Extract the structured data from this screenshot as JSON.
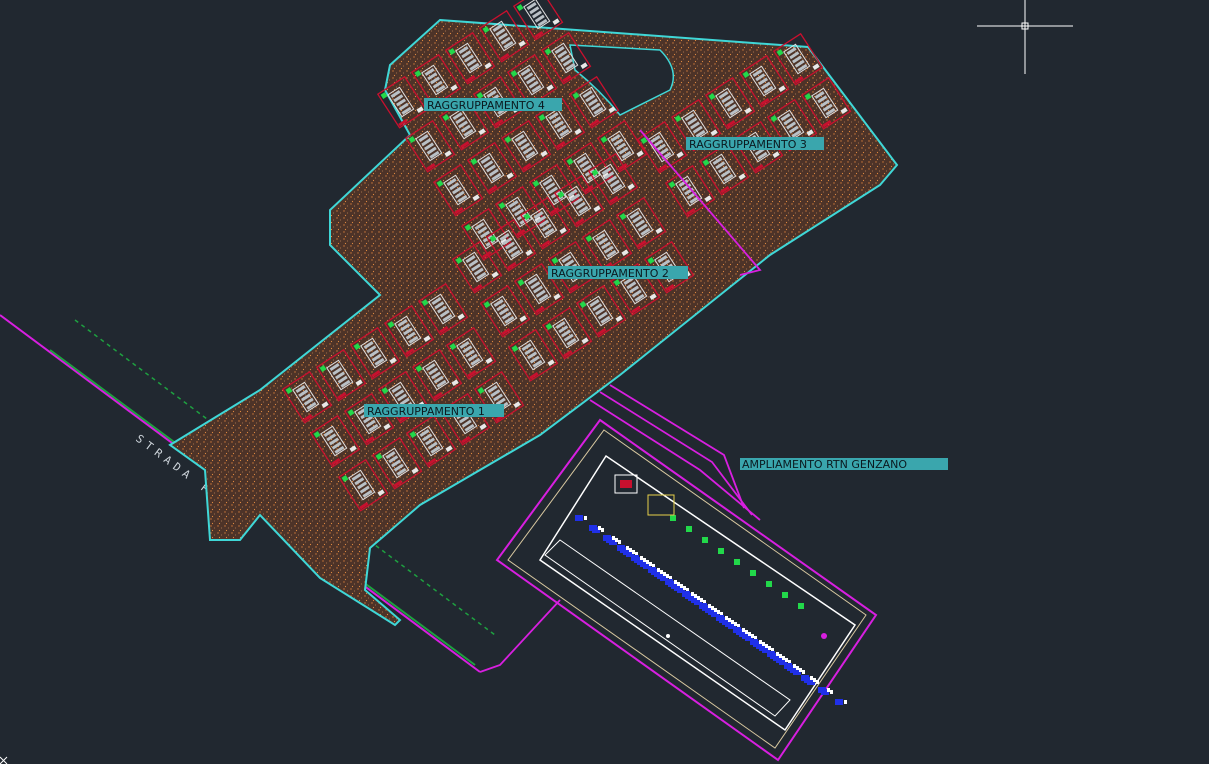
{
  "drawing": {
    "labels": {
      "group1": "RAGGRUPPAMENTO 1",
      "group2": "RAGGRUPPAMENTO 2",
      "group3": "RAGGRUPPAMENTO 3",
      "group4": "RAGGRUPPAMENTO 4",
      "substation": "AMPLIAMENTO RTN GENZANO",
      "road": "STRADA PRO"
    },
    "colors": {
      "background": "#212830",
      "site_boundary": "#3fd7d7",
      "gravel": "#5a3a2c",
      "cable_route": "#d81fe0",
      "building": "#c8102e",
      "equipment": "#22d84a",
      "label_bg": "#3aa6ad",
      "substation_equipment": "#2030e8",
      "road_edge": "#1ea040"
    }
  }
}
